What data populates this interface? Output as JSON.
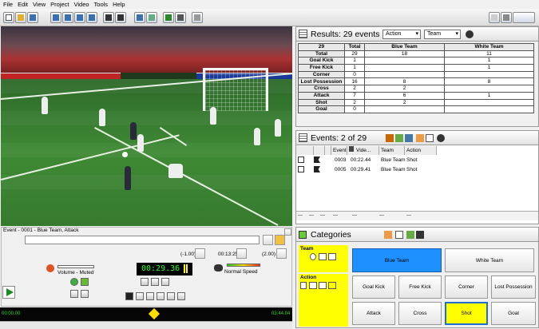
{
  "menu": [
    "File",
    "Edit",
    "View",
    "Project",
    "Video",
    "Tools",
    "Help"
  ],
  "player": {
    "event_title": "Event - 0001 - Blue Team, Attack",
    "lead_in": "(-1.00)",
    "clip_end": "00:13:25",
    "lead_out": "(2.00)",
    "current_time": "00:29.36",
    "volume_label": "Volume - Muted",
    "speed_label": "Normal Speed",
    "timeline_start": "00:00.00",
    "timeline_end": "03:44.04"
  },
  "results": {
    "title": "Results: 29 events",
    "action_select": "Action",
    "team_select": "Team",
    "header": [
      "29",
      "Total",
      "Blue Team",
      "White Team"
    ],
    "rows": [
      [
        "Total",
        "29",
        "18",
        "11"
      ],
      [
        "Goal Kick",
        "1",
        "",
        "1"
      ],
      [
        "Free Kick",
        "1",
        "",
        "1"
      ],
      [
        "Corner",
        "0",
        "",
        ""
      ],
      [
        "Lost Possession",
        "16",
        "8",
        "8"
      ],
      [
        "Cross",
        "2",
        "2",
        ""
      ],
      [
        "Attack",
        "7",
        "6",
        "1"
      ],
      [
        "Shot",
        "2",
        "2",
        ""
      ],
      [
        "Goal",
        "0",
        "",
        ""
      ]
    ]
  },
  "events": {
    "title": "Events: 2 of 29",
    "columns": [
      "Event",
      "Vide...",
      "Team",
      "Action"
    ],
    "rows": [
      {
        "event": "0003",
        "video": "00:22.44",
        "team": "Blue Team",
        "action": "Shot"
      },
      {
        "event": "0005",
        "video": "00:29.41",
        "team": "Blue Team",
        "action": "Shot"
      }
    ],
    "footer": [
      "---",
      "---",
      "---",
      "---",
      "---",
      "---",
      "---"
    ]
  },
  "categories": {
    "title": "Categories",
    "team_label": "Team",
    "action_label": "Action",
    "teams": [
      "Blue Team",
      "White Team"
    ],
    "actions_row1": [
      "Goal Kick",
      "Free Kick",
      "Corner",
      "Lost Possession"
    ],
    "actions_row2": [
      "Attack",
      "Cross",
      "Shot",
      "Goal"
    ]
  },
  "colors": {
    "blue_selected": "#1e90ff",
    "shot_selected": "#ffff00",
    "timecode": "#22ff22"
  }
}
